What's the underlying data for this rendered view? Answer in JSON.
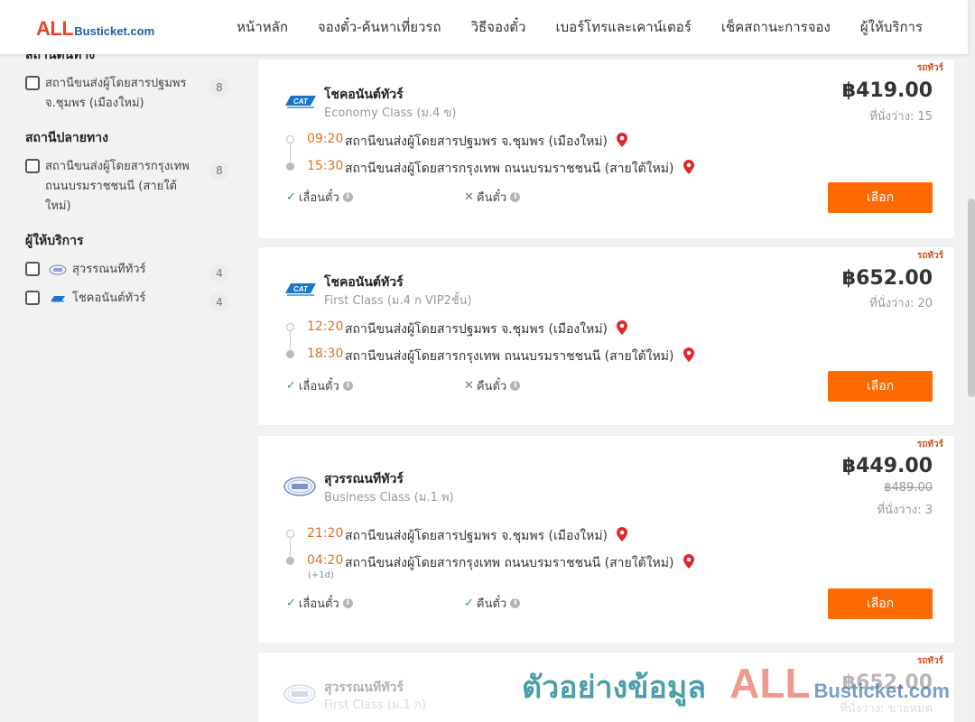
{
  "header": {
    "logo_all": "ALL",
    "logo_rest": "Busticket.com",
    "nav": [
      "หน้าหลัก",
      "จองตั๋ว-ค้นหาเที่ยวรถ",
      "วิธีจองตั๋ว",
      "เบอร์โทรและเคาน์เตอร์",
      "เช็คสถานะการจอง",
      "ผู้ให้บริการ"
    ]
  },
  "sidebar": {
    "origin_title": "สถานีต้นทาง",
    "origin_items": [
      {
        "label": "สถานีขนส่งผู้โดยสารปฐมพร จ.ชุมพร (เมืองใหม่)",
        "count": "8"
      }
    ],
    "dest_title": "สถานีปลายทาง",
    "dest_items": [
      {
        "label": "สถานีขนส่งผู้โดยสารกรุงเทพ ถนนบรมราชชนนี (สายใต้ใหม่)",
        "count": "8"
      }
    ],
    "operator_title": "ผู้ให้บริการ",
    "operator_items": [
      {
        "label": "สุวรรณนทีทัวร์",
        "count": "4"
      },
      {
        "label": "โชคอนันต์ทัวร์",
        "count": "4"
      }
    ]
  },
  "trips": [
    {
      "tag": "รถทัวร์",
      "operator": "โชคอนันต์ทัวร์",
      "class": "Economy Class (ม.4 ข)",
      "price": "฿419.00",
      "seats": "ที่นั่งว่าง: 15",
      "depart_time": "09:20",
      "depart_station": "สถานีขนส่งผู้โดยสารปฐมพร จ.ชุมพร (เมืองใหม่)",
      "arrive_time": "15:30",
      "arrive_station": "สถานีขนส่งผู้โดยสารกรุงเทพ ถนนบรมราชชนนี (สายใต้ใหม่)",
      "feature1": "เลื่อนตั๋ว",
      "feature2": "คืนตั๋ว",
      "button": "เลือก"
    },
    {
      "tag": "รถทัวร์",
      "operator": "โชคอนันต์ทัวร์",
      "class": "First Class (ม.4 ก VIP2ชั้น)",
      "price": "฿652.00",
      "seats": "ที่นั่งว่าง: 20",
      "depart_time": "12:20",
      "depart_station": "สถานีขนส่งผู้โดยสารปฐมพร จ.ชุมพร (เมืองใหม่)",
      "arrive_time": "18:30",
      "arrive_station": "สถานีขนส่งผู้โดยสารกรุงเทพ ถนนบรมราชชนนี (สายใต้ใหม่)",
      "feature1": "เลื่อนตั๋ว",
      "feature2": "คืนตั๋ว",
      "button": "เลือก"
    },
    {
      "tag": "รถทัวร์",
      "operator": "สุวรรณนทีทัวร์",
      "class": "Business Class (ม.1 พ)",
      "price": "฿449.00",
      "old_price": "฿489.00",
      "seats": "ที่นั่งว่าง: 3",
      "depart_time": "21:20",
      "depart_station": "สถานีขนส่งผู้โดยสารปฐมพร จ.ชุมพร (เมืองใหม่)",
      "arrive_time": "04:20",
      "arrive_plus": "(+1d)",
      "arrive_station": "สถานีขนส่งผู้โดยสารกรุงเทพ ถนนบรมราชชนนี (สายใต้ใหม่)",
      "feature1": "เลื่อนตั๋ว",
      "feature2": "คืนตั๋ว",
      "button": "เลือก"
    },
    {
      "tag": "รถทัวร์",
      "operator": "สุวรรณนทีทัวร์",
      "class": "First Class (ม.1 ก)",
      "price": "฿652.00",
      "seats": "ที่นั่งว่าง: ขายหมด"
    }
  ],
  "watermark": {
    "text": "ตัวอย่างข้อมูล",
    "brand_all": "ALL",
    "brand_rest": "Busticket.com"
  },
  "colors": {
    "accent": "#ff6a00",
    "time": "#e07020",
    "check": "#2aa54a",
    "pin": "#e0262a"
  }
}
